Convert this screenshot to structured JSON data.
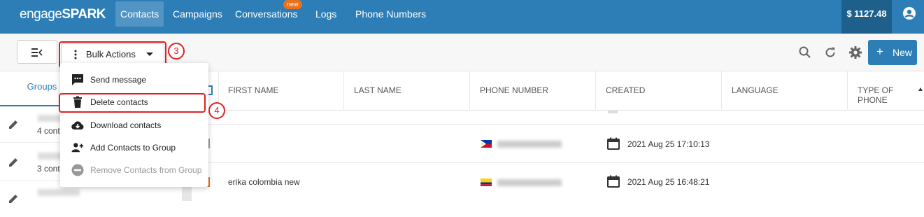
{
  "app": {
    "logo_part1": "engage",
    "logo_part2": "SPARK",
    "nav": [
      {
        "label": "Contacts",
        "active": true
      },
      {
        "label": "Campaigns"
      },
      {
        "label": "Conversations",
        "badge": "new"
      },
      {
        "label": "Logs"
      },
      {
        "label": "Phone Numbers"
      }
    ],
    "balance": "$ 1127.48",
    "brand_color": "#2d7eb7"
  },
  "toolbar": {
    "bulk_actions_label": "Bulk Actions",
    "new_label": "New",
    "icons": [
      "collapse-sidebar-icon",
      "search-icon",
      "refresh-icon",
      "gear-icon",
      "plus-icon"
    ]
  },
  "annotations": {
    "step_bulk": "3",
    "step_delete": "4"
  },
  "bulk_menu": {
    "items": [
      {
        "label": "Send message",
        "icon": "message-icon"
      },
      {
        "label": "Delete contacts",
        "icon": "trash-icon"
      },
      {
        "label": "Download contacts",
        "icon": "cloud-download-icon"
      },
      {
        "label": "Add Contacts to Group",
        "icon": "add-user-icon"
      },
      {
        "label": "Remove Contacts from Group",
        "icon": "remove-circle-icon",
        "disabled": true
      }
    ]
  },
  "sidebar": {
    "tab_label": "Groups",
    "rows": [
      {
        "count_text": "4 cont"
      },
      {
        "count_text": "3 cont"
      },
      {
        "count_text": ""
      }
    ]
  },
  "table": {
    "columns": [
      "FIRST NAME",
      "LAST NAME",
      "PHONE NUMBER",
      "CREATED",
      "LANGUAGE",
      "TYPE OF PHONE"
    ],
    "rows": [
      {
        "first_name": "",
        "flag": "philippines",
        "created": "2021 Aug 25 17:10:13"
      },
      {
        "first_name": "erika colombia new",
        "flag": "colombia",
        "created": "2021 Aug 25 16:48:21"
      }
    ]
  }
}
